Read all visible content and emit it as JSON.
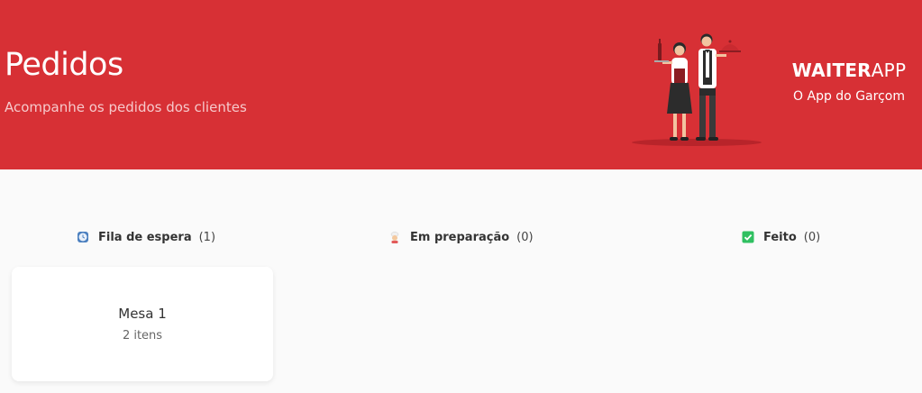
{
  "header": {
    "title": "Pedidos",
    "subtitle": "Acompanhe os pedidos dos clientes",
    "background_color": "#d73035"
  },
  "brand": {
    "logo_bold": "WAITER",
    "logo_light": "APP",
    "tagline": "O App do Garçom"
  },
  "columns": [
    {
      "icon": "clock-icon",
      "label": "Fila de espera",
      "count": "(1)"
    },
    {
      "icon": "chef-icon",
      "label": "Em preparação",
      "count": "(0)"
    },
    {
      "icon": "check-icon",
      "label": "Feito",
      "count": "(0)",
      "icon_color": "#30c061"
    }
  ],
  "orders": [
    {
      "table": "Mesa 1",
      "items": "2 itens"
    }
  ]
}
